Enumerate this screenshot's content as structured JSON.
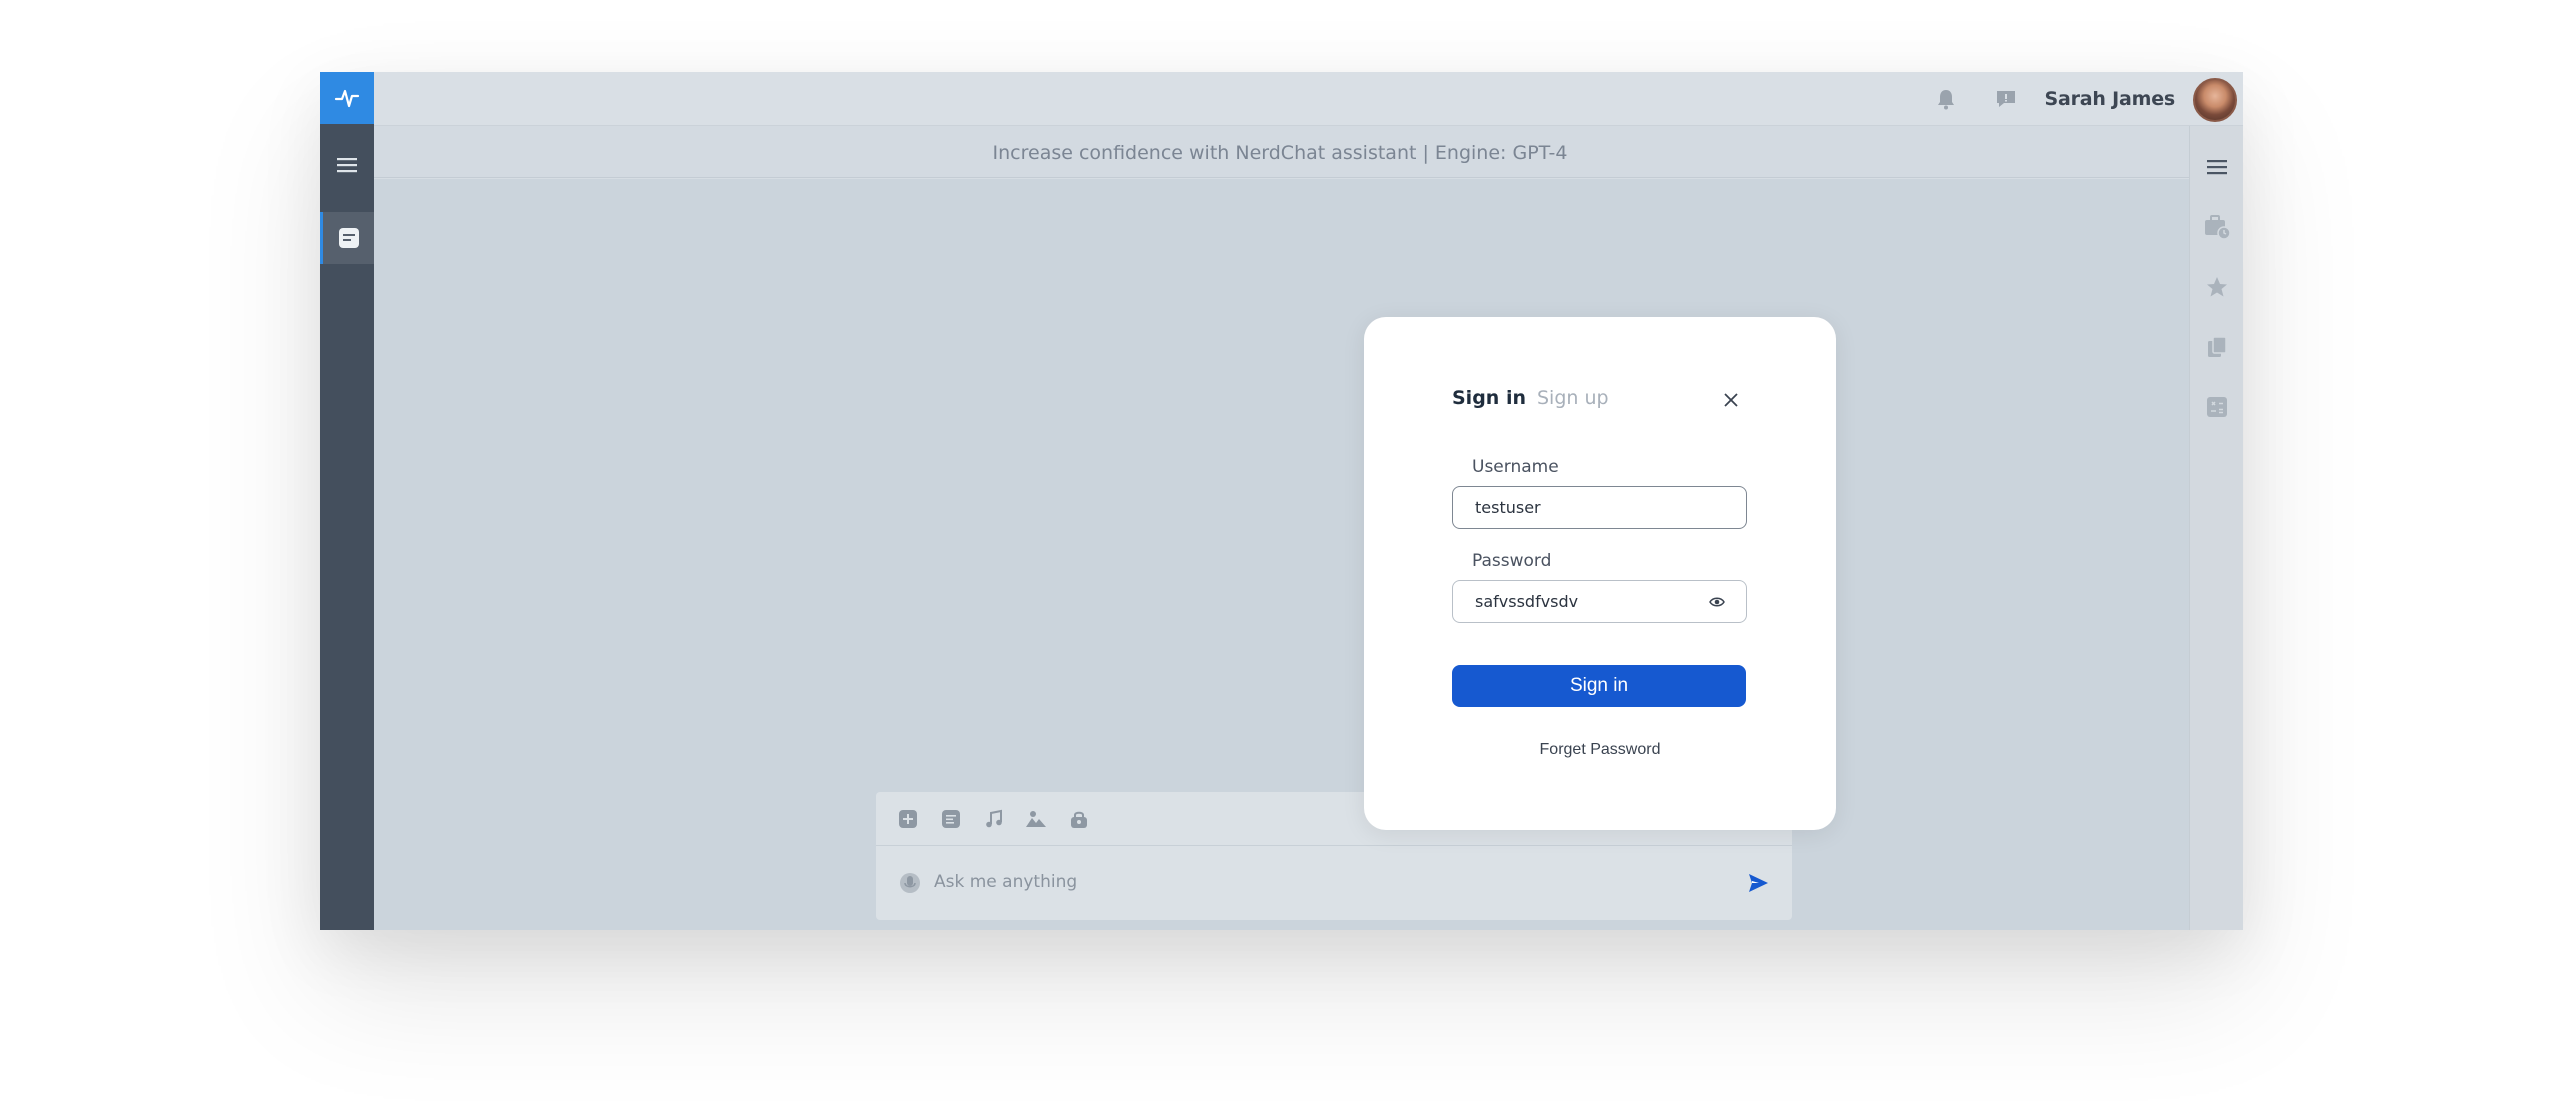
{
  "header": {
    "user_name": "Sarah James",
    "notification_icon": "bell-icon",
    "messages_icon": "chat-bubble-icon",
    "avatar_icon": "user-avatar"
  },
  "subbar": {
    "subtitle": "Increase confidence with NerdChat assistant | Engine: GPT-4"
  },
  "sidebar": {
    "logo_icon": "pulse-icon",
    "menu_icon": "hamburger-icon",
    "items": [
      {
        "icon": "chat-icon",
        "active": true
      }
    ]
  },
  "rightbar": {
    "items": [
      "hamburger-icon",
      "briefcase-clock-icon",
      "star-icon",
      "books-icon",
      "calculator-icon"
    ]
  },
  "composer": {
    "placeholder": "Ask me anything",
    "tools": [
      "add-icon",
      "document-icon",
      "music-icon",
      "image-icon",
      "lock-icon"
    ],
    "grid_icon": "apps-grid-icon",
    "mic_icon": "microphone-icon",
    "send_icon": "send-icon"
  },
  "modal": {
    "tab_signin": "Sign in",
    "tab_signup": "Sign up",
    "username_label": "Username",
    "username_value": "testuser",
    "password_label": "Password",
    "password_value": "safvssdfvsdv",
    "submit_label": "Sign in",
    "forget_label": "Forget Password"
  },
  "colors": {
    "brand": "#2f8ae3",
    "sidebar": "#444f5d",
    "primary_button": "#1659d0",
    "background": "#cbd4dc"
  }
}
